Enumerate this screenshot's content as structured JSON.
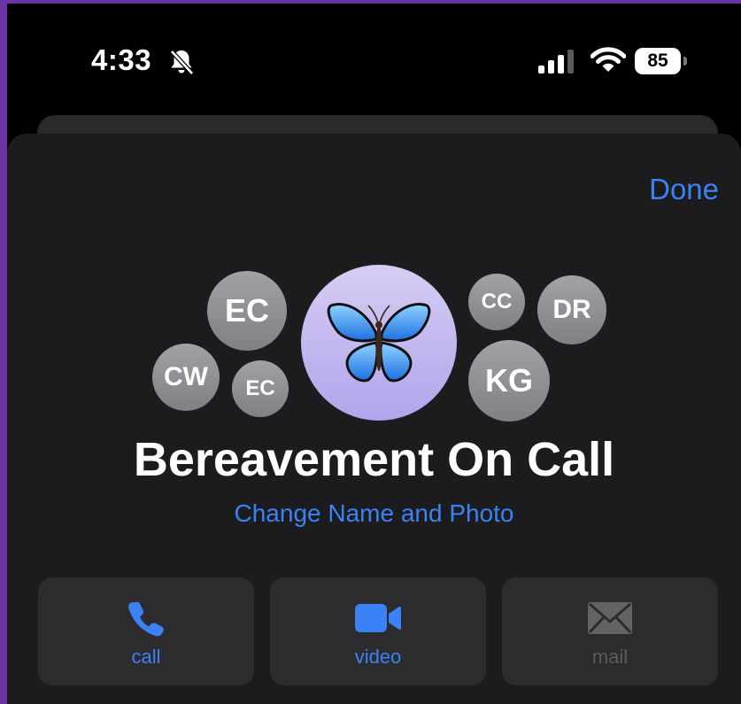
{
  "status_bar": {
    "time": "4:33",
    "battery": "85",
    "icons": [
      "bell-slash-icon",
      "cellular-signal-icon",
      "wifi-icon",
      "battery-icon"
    ]
  },
  "header": {
    "done_label": "Done"
  },
  "group": {
    "name": "Bereavement On Call",
    "change_link": "Change Name and Photo",
    "photo_icon": "butterfly-emoji",
    "members": [
      "EC",
      "CW",
      "EC",
      "CC",
      "DR",
      "KG"
    ]
  },
  "actions": [
    {
      "label": "call",
      "icon": "phone-icon",
      "enabled": true
    },
    {
      "label": "video",
      "icon": "video-camera-icon",
      "enabled": true
    },
    {
      "label": "mail",
      "icon": "envelope-icon",
      "enabled": false
    }
  ],
  "colors": {
    "accent": "#3b82f6",
    "sheet_bg": "#1c1c1e",
    "button_bg": "#2c2c2e",
    "outer_frame": "#6b34a6"
  }
}
